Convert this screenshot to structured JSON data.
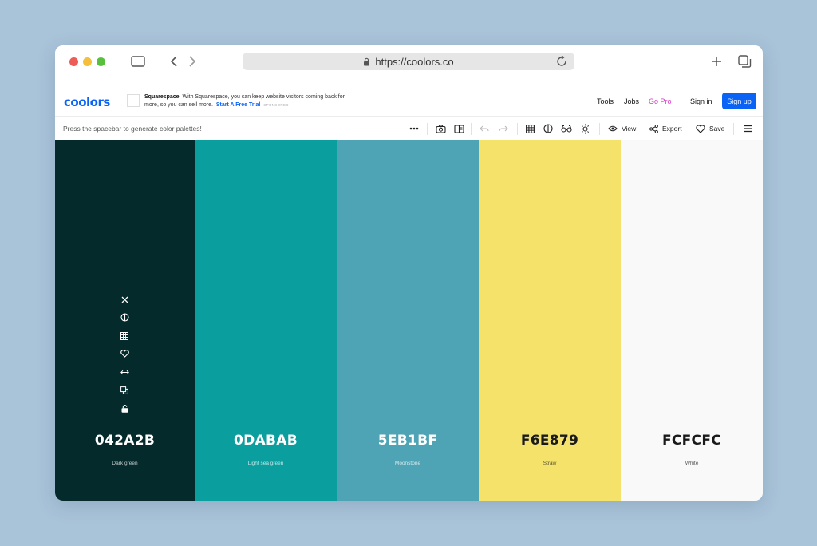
{
  "browser": {
    "url": "https://coolors.co"
  },
  "header": {
    "logo": "coolors",
    "ad": {
      "brand": "Squarespace",
      "text": "With Squarespace, you can keep website visitors coming back for more, so you can sell more.",
      "cta": "Start A Free Trial",
      "sponsored": "SPONSORED"
    },
    "nav": {
      "tools": "Tools",
      "jobs": "Jobs",
      "gopro": "Go Pro",
      "signin": "Sign in",
      "signup": "Sign up"
    }
  },
  "toolbar": {
    "hint": "Press the spacebar to generate color palettes!",
    "view_label": "View",
    "export_label": "Export",
    "save_label": "Save"
  },
  "palette": [
    {
      "hex": "042A2B",
      "name": "Dark green",
      "color": "#042A2B",
      "text_color": "#ffffff"
    },
    {
      "hex": "0DABAB",
      "name": "Light sea green",
      "color": "#0A9E9E",
      "text_color": "#ffffff"
    },
    {
      "hex": "5EB1BF",
      "name": "Moonstone",
      "color": "#4EA3B5",
      "text_color": "#ffffff"
    },
    {
      "hex": "F6E879",
      "name": "Straw",
      "color": "#F4E26A",
      "text_color": "#1a1a1a"
    },
    {
      "hex": "FCFCFC",
      "name": "White",
      "color": "#F9F9F9",
      "text_color": "#1a1a1a"
    }
  ],
  "icons": {
    "swatch_tools": [
      "close-icon",
      "contrast-icon",
      "shades-grid-icon",
      "heart-icon",
      "drag-arrows-icon",
      "copy-icon",
      "lock-icon"
    ]
  }
}
